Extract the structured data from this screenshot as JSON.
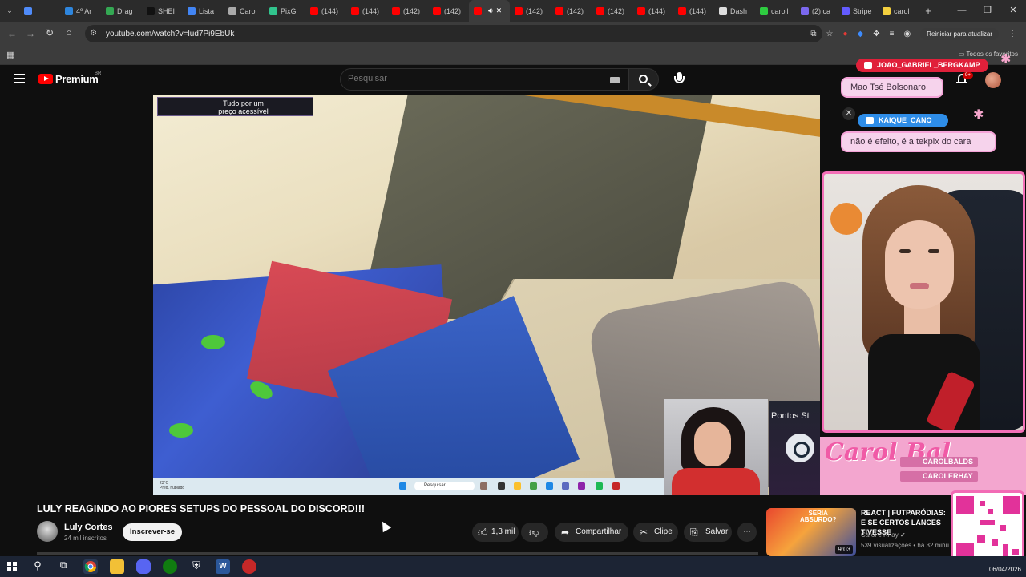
{
  "browser": {
    "tabs": [
      {
        "label": "",
        "color": "#4f8bf9"
      },
      {
        "label": "4º Ar",
        "color": "#2e86de"
      },
      {
        "label": "Drag",
        "color": "#34a853"
      },
      {
        "label": "SHEI",
        "color": "#111111"
      },
      {
        "label": "Lista",
        "color": "#4285f4"
      },
      {
        "label": "Carol",
        "color": "#aaaaaa"
      },
      {
        "label": "PixG",
        "color": "#31c48d"
      },
      {
        "label": "(144)",
        "color": "#ff0000"
      },
      {
        "label": "(144)",
        "color": "#ff0000"
      },
      {
        "label": "(142)",
        "color": "#ff0000"
      },
      {
        "label": "(142)",
        "color": "#ff0000"
      },
      {
        "label": "",
        "color": "#ff0000",
        "active": true
      },
      {
        "label": "(142)",
        "color": "#ff0000"
      },
      {
        "label": "(142)",
        "color": "#ff0000"
      },
      {
        "label": "(142)",
        "color": "#ff0000"
      },
      {
        "label": "(144)",
        "color": "#ff0000"
      },
      {
        "label": "(144)",
        "color": "#ff0000"
      },
      {
        "label": "Dash",
        "color": "#dddddd"
      },
      {
        "label": "caroll",
        "color": "#2ecc40"
      },
      {
        "label": "(2) ca",
        "color": "#7b68ee"
      },
      {
        "label": "Stripe",
        "color": "#635bff"
      },
      {
        "label": "carol",
        "color": "#f4d03f"
      }
    ],
    "new_tab": "+",
    "url": "youtube.com/watch?v=lud7Pi9EbUk",
    "restart_label": "Reiniciar para atualizar",
    "bookmarks_all": "Todos os favoritos"
  },
  "youtube": {
    "logo_text": "Premium",
    "country": "BR",
    "search_placeholder": "Pesquisar",
    "notif_count": "9+"
  },
  "video": {
    "promo_text_1": "Tudo por um",
    "promo_text_2": "preço acessível",
    "inner_search": "Pesquisar",
    "inner_weather": "23°C",
    "inner_weather_2": "Pred. nublado",
    "steam_text": "Pontos St"
  },
  "overlay": {
    "chat": [
      {
        "user": "JOAO_GABRIEL_BERGKAMP",
        "message": "Mao Tsé Bolsonaro",
        "name_color": "#e0203a"
      },
      {
        "user": "KAIQUE_CANO__",
        "message": "não é efeito, é a tekpix do cara",
        "name_color": "#2e8de8"
      }
    ],
    "brand": "Carol Bal",
    "handles": [
      "CAROLBALDS",
      "CAROLERHAY"
    ]
  },
  "details": {
    "title": "LULY REAGINDO AO PIORES SETUPS DO PESSOAL DO DISCORD!!!",
    "channel": "Luly Cortes",
    "subscribers": "24 mil inscritos",
    "subscribe_label": "Inscrever-se",
    "likes": "1,3 mil",
    "share_label": "Compartilhar",
    "clip_label": "Clipe",
    "save_label": "Salvar",
    "more": "⋯"
  },
  "related": {
    "thumb_text_1": "SERIA",
    "thumb_text_2": "ABSURDO?",
    "duration": "9:03",
    "title": "REACT | FUTPARÓDIAS: E SE CERTOS LANCES TIVESSE",
    "channel": "Carol e Rhay",
    "views": "539 visualizações • há 32 minu"
  },
  "taskbar": {
    "date": "06/04/2026"
  }
}
